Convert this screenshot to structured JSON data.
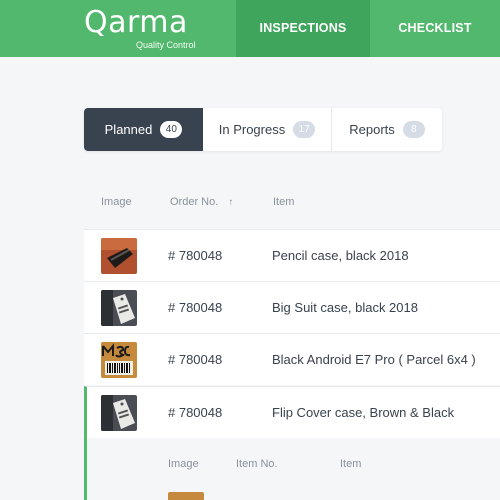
{
  "header": {
    "logo_text": "Qarma",
    "logo_subtitle": "Quality Control",
    "nav": [
      {
        "label": "INSPECTIONS",
        "active": true
      },
      {
        "label": "CHECKLIST",
        "active": false
      }
    ]
  },
  "tabs": [
    {
      "label": "Planned",
      "count": "40",
      "active": true
    },
    {
      "label": "In Progress",
      "count": "17",
      "active": false
    },
    {
      "label": "Reports",
      "count": "8",
      "active": false
    }
  ],
  "table": {
    "columns": [
      "Image",
      "Order No.",
      "Item"
    ],
    "rows": [
      {
        "order": "# 780048",
        "item": "Pencil case, black 2018",
        "thumb": "black-pencil-case-photo"
      },
      {
        "order": "# 780048",
        "item": "Big Suit case, black 2018",
        "thumb": "clothing-tag-photo"
      },
      {
        "order": "# 780048",
        "item": "Black Android E7 Pro ( Parcel 6x4 )",
        "thumb": "msc-box-barcode-photo"
      },
      {
        "order": "# 780048",
        "item": "Flip Cover case, Brown & Black",
        "thumb": "clothing-tag-photo"
      }
    ],
    "subtable_columns": [
      "Image",
      "Item No.",
      "Item"
    ]
  },
  "colors": {
    "brand_green": "#52b86e",
    "nav_active_green": "#3fa55c",
    "tab_active_bg": "#39434f",
    "badge_muted": "#d5dce6"
  }
}
